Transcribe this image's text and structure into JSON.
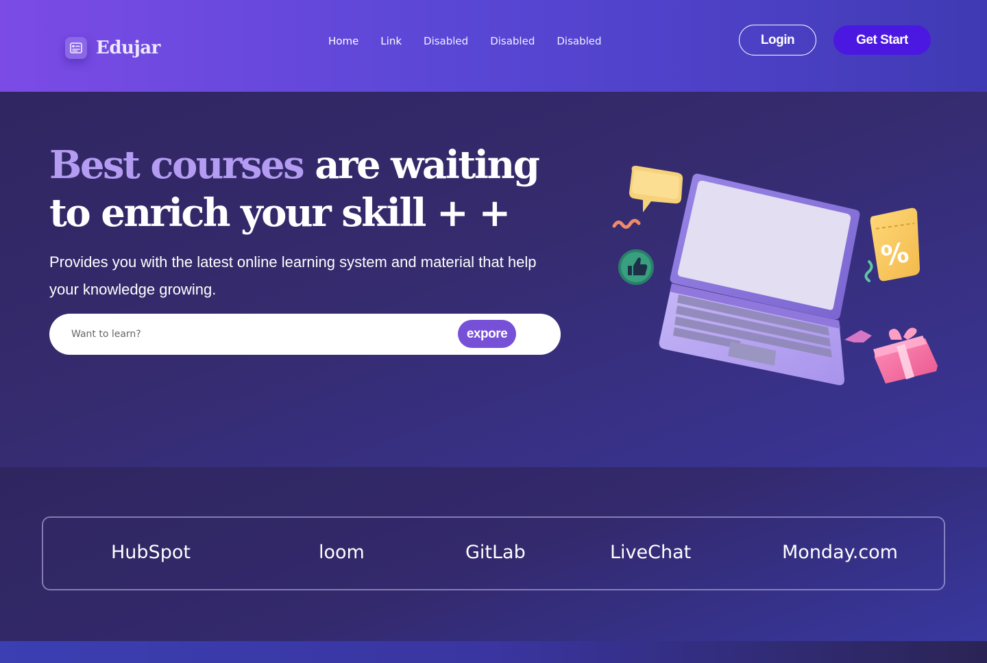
{
  "brand": {
    "name": "Edujar",
    "icon": "course-list-icon"
  },
  "nav": {
    "links": [
      {
        "label": "Home",
        "state": "active"
      },
      {
        "label": "Link",
        "state": "normal"
      },
      {
        "label": "Disabled",
        "state": "disabled"
      },
      {
        "label": "Disabled",
        "state": "disabled"
      },
      {
        "label": "Disabled",
        "state": "disabled"
      }
    ],
    "login_label": "Login",
    "start_label": "Get Start"
  },
  "hero": {
    "title_accent": "Best courses",
    "title_rest": "are waiting to enrich your skill + +",
    "subtitle": "Provides you with the latest online learning system and material that help your knowledge growing.",
    "search": {
      "placeholder": "Want to learn?",
      "value": ""
    },
    "explore_label": "expore"
  },
  "partners": [
    "HubSpot",
    "loom",
    "GitLab",
    "LiveChat",
    "Monday.com"
  ],
  "colors": {
    "accent_text": "#b49cf3",
    "cta_primary": "#4a18e0",
    "explore_button": "#7750d8",
    "nav_gradient_start": "#7c4be6",
    "nav_gradient_end": "#3f3ab3"
  }
}
